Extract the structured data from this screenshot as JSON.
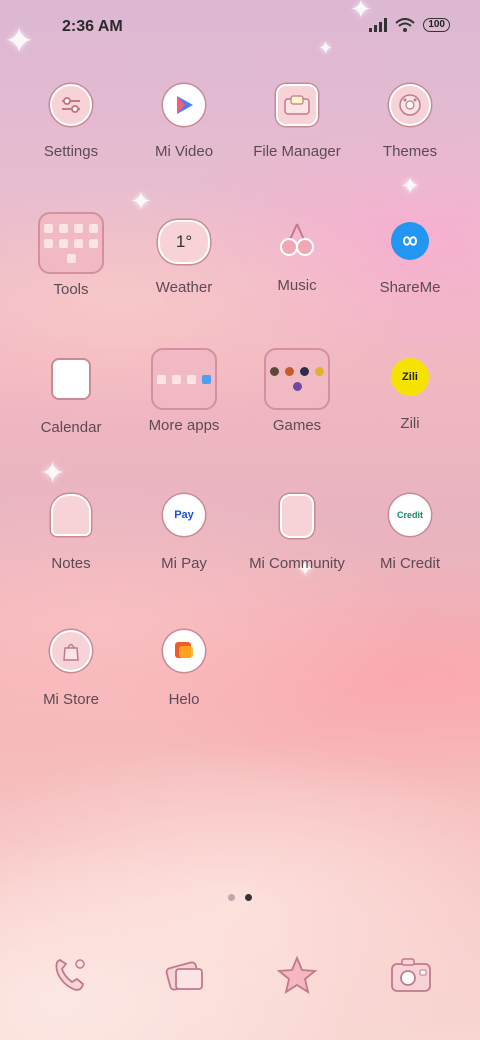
{
  "status": {
    "time": "2:36 AM",
    "battery": "100"
  },
  "apps": [
    {
      "label": "Settings",
      "icon": "settings-icon"
    },
    {
      "label": "Mi Video",
      "icon": "play-icon"
    },
    {
      "label": "File Manager",
      "icon": "folder-icon"
    },
    {
      "label": "Themes",
      "icon": "palette-icon"
    },
    {
      "label": "Tools",
      "icon": "folder-icon"
    },
    {
      "label": "Weather",
      "icon": "cloud-icon",
      "value": "1°"
    },
    {
      "label": "Music",
      "icon": "cherry-icon"
    },
    {
      "label": "ShareMe",
      "icon": "infinity-icon"
    },
    {
      "label": "Calendar",
      "icon": "calendar-icon"
    },
    {
      "label": "More apps",
      "icon": "folder-icon"
    },
    {
      "label": "Games",
      "icon": "folder-icon"
    },
    {
      "label": "Zili",
      "icon": "zili-icon",
      "badge": "Zili"
    },
    {
      "label": "Notes",
      "icon": "ghost-icon"
    },
    {
      "label": "Mi Pay",
      "icon": "mi-pay-icon",
      "badge": "Pay"
    },
    {
      "label": "Mi Community",
      "icon": "chat-icon"
    },
    {
      "label": "Mi Credit",
      "icon": "mi-credit-icon",
      "badge": "Credit"
    },
    {
      "label": "Mi Store",
      "icon": "bag-icon"
    },
    {
      "label": "Helo",
      "icon": "helo-icon"
    }
  ],
  "page_indicator": {
    "count": 2,
    "active": 2
  },
  "dock": [
    "phone-icon",
    "messages-icon",
    "star-icon",
    "camera-icon"
  ]
}
